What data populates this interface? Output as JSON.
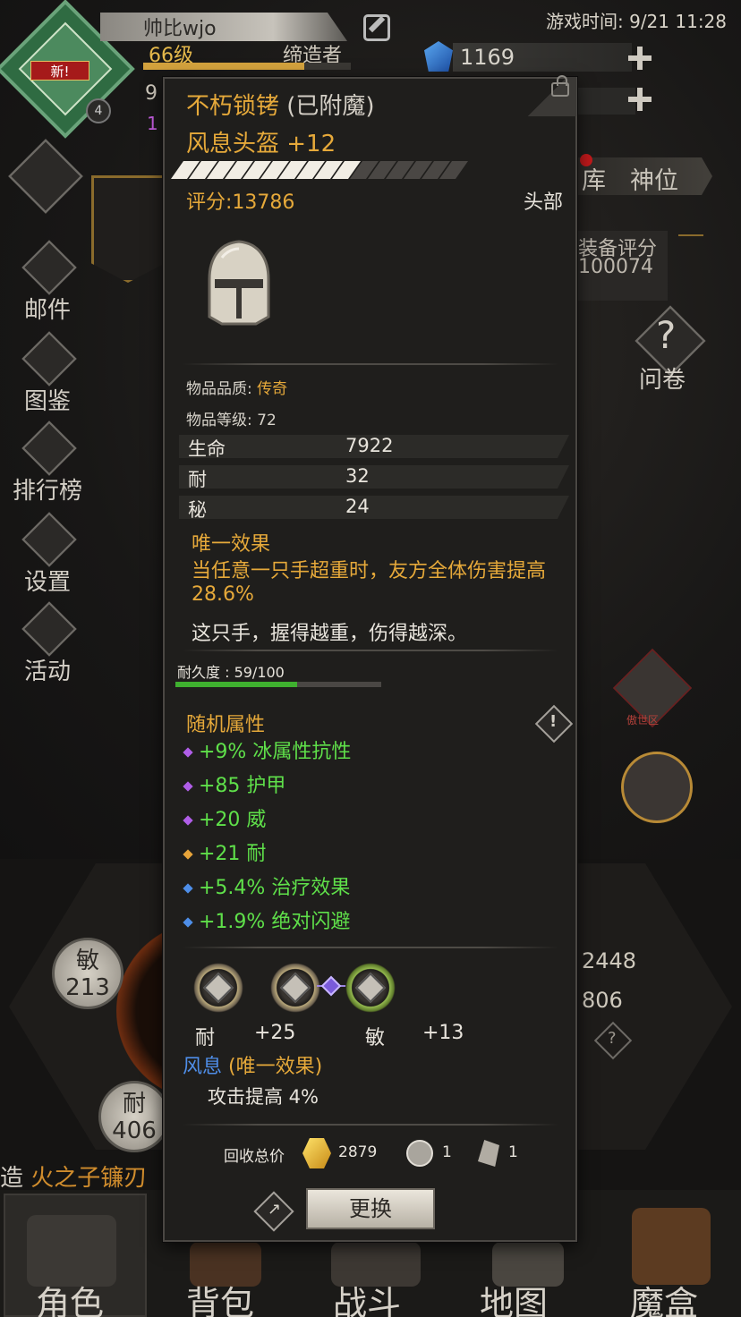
{
  "player": {
    "name": "帅比wjo",
    "level": "66级",
    "title": "缔造者",
    "new_badge": "新!",
    "avatar_level": "4",
    "hp_fragment": "9",
    "mp_fragment": "1"
  },
  "game_time": "游戏时间: 9/21 11:28",
  "currency": {
    "gems": "1169"
  },
  "sidebar": {
    "items": [
      {
        "label": "邮件",
        "icon": "mail-icon"
      },
      {
        "label": "图鉴",
        "icon": "book-icon"
      },
      {
        "label": "排行榜",
        "icon": "leaderboard-icon"
      },
      {
        "label": "设置",
        "icon": "gear-icon"
      },
      {
        "label": "活动",
        "icon": "event-icon"
      }
    ]
  },
  "right_panel": {
    "tab_partial": "库",
    "tab_shenwei": "神位",
    "equip_score_label": "装备评分",
    "equip_score_value": "100074",
    "survey_label": "问卷",
    "helm_label": "傲世区",
    "num_a": "2448",
    "num_b": "806"
  },
  "stats_circles": [
    {
      "label": "敏",
      "value": "213"
    },
    {
      "label": "耐",
      "value": "406"
    }
  ],
  "forge": {
    "prefix": "造",
    "item": "火之子镰刃"
  },
  "nav": {
    "items": [
      "角色",
      "背包",
      "战斗",
      "地图",
      "魔盒"
    ],
    "selected": 0
  },
  "tooltip": {
    "name": "不朽锁铐",
    "enchanted": "(已附魔)",
    "subtitle": "风息头盔 +12",
    "quality_fill": 0.6,
    "score": "评分:13786",
    "slot": "头部",
    "quality_label": "物品品质: ",
    "quality_value": "传奇",
    "item_level_label": "物品等级: 72",
    "base_stats": [
      {
        "k": "生命",
        "v": "7922"
      },
      {
        "k": "耐",
        "v": "32"
      },
      {
        "k": "秘",
        "v": "24"
      }
    ],
    "unique_title": "唯一效果",
    "unique_desc": "当任意一只手超重时，友方全体伤害提高 28.6%",
    "flavor": "这只手，握得越重，伤得越深。",
    "durability_label": "耐久度 : 59/100",
    "durability": {
      "current": 59,
      "max": 100
    },
    "random_title": "随机属性",
    "affixes": [
      {
        "text": "+9% 冰属性抗性",
        "color": "#b05ee8"
      },
      {
        "text": "+85 护甲",
        "color": "#b05ee8"
      },
      {
        "text": "+20 威",
        "color": "#b05ee8"
      },
      {
        "text": "+21 耐",
        "color": "#e7a43a"
      },
      {
        "text": "+5.4% 治疗效果",
        "color": "#4e8ee8"
      },
      {
        "text": "+1.9% 绝对闪避",
        "color": "#4e8ee8"
      }
    ],
    "sockets": [
      {
        "k": "耐",
        "v": "+25"
      },
      {
        "k": "敏",
        "v": "+13"
      }
    ],
    "set_name": "风息",
    "set_tag": "(唯一效果)",
    "set_effect": "攻击提高 4%",
    "recycle_label": "回收总价",
    "recycle_gold": "2879",
    "recycle_mat1": "1",
    "recycle_mat2": "1",
    "replace_button": "更换"
  },
  "colors": {
    "gold": "#e6a93a",
    "green": "#5fe04a",
    "blue": "#4f8ee8",
    "purple": "#b05ee8"
  }
}
